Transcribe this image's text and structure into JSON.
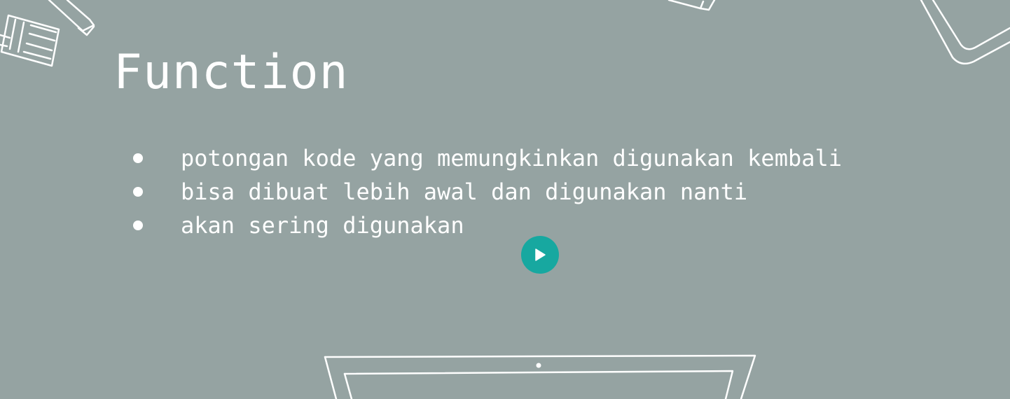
{
  "slide": {
    "title": "Function",
    "bullets": [
      "potongan kode yang memungkinkan digunakan kembali",
      "bisa dibuat lebih awal dan digunakan nanti",
      "akan sering digunakan"
    ]
  },
  "player": {
    "play_icon": "play-icon",
    "accent_color": "#17a8a0"
  },
  "colors": {
    "background": "#95a3a2",
    "text": "#ffffff"
  }
}
